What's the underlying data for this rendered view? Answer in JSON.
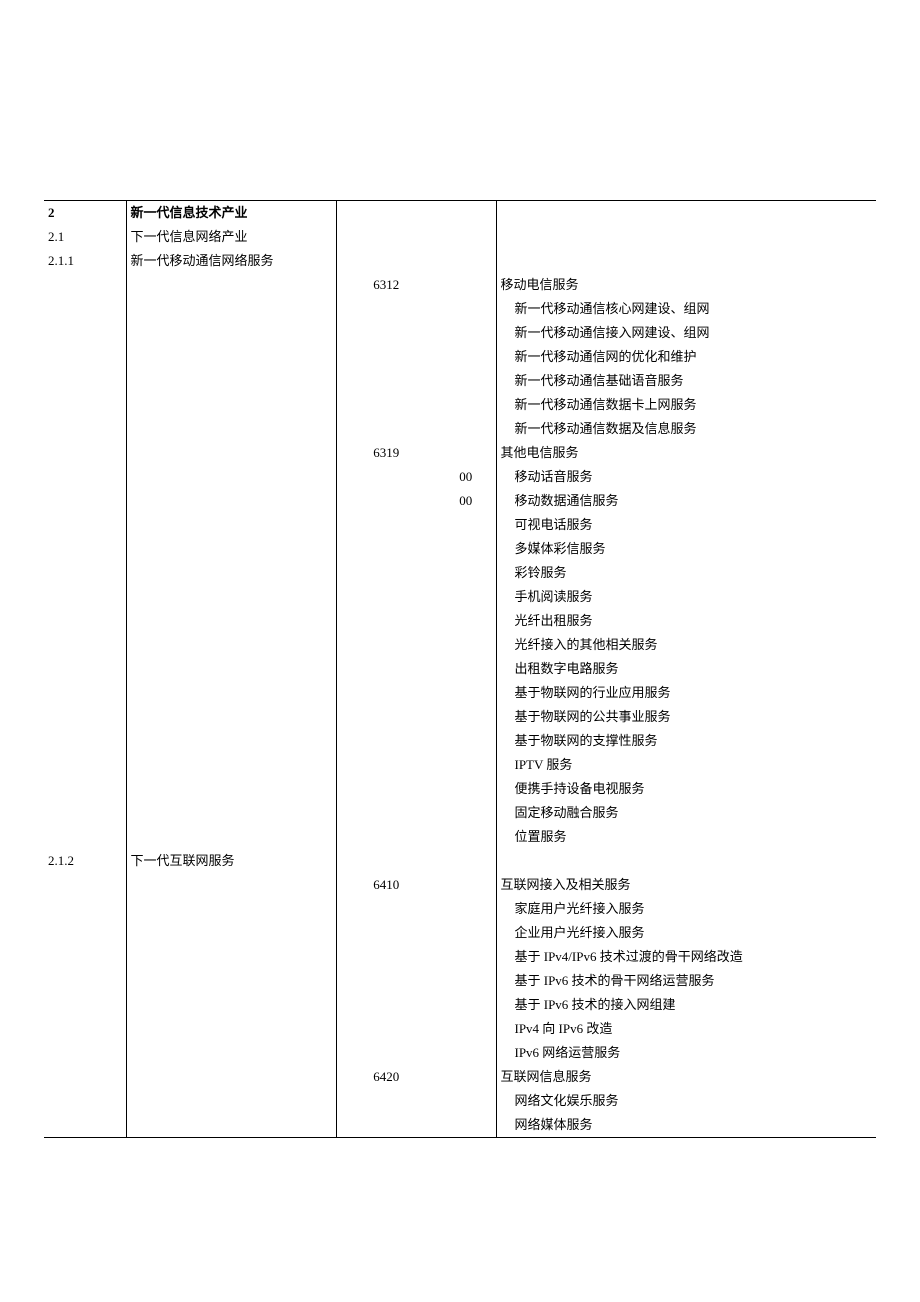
{
  "rows": [
    {
      "code": "2",
      "name": "新一代信息技术产业",
      "bold": true
    },
    {
      "code": "2.1",
      "name": "下一代信息网络产业"
    },
    {
      "code": "2.1.1",
      "name": "新一代移动通信网络服务"
    },
    {
      "num1": "6312",
      "desc": "移动电信服务"
    },
    {
      "desc": "新一代移动通信核心网建设、组网",
      "indent": 1
    },
    {
      "desc": "新一代移动通信接入网建设、组网",
      "indent": 1
    },
    {
      "desc": "新一代移动通信网的优化和维护",
      "indent": 1
    },
    {
      "desc": "新一代移动通信基础语音服务",
      "indent": 1
    },
    {
      "desc": "新一代移动通信数据卡上网服务",
      "indent": 1
    },
    {
      "desc": "新一代移动通信数据及信息服务",
      "indent": 1
    },
    {
      "num1": "6319",
      "desc": "其他电信服务"
    },
    {
      "num2": "00",
      "desc": "移动话音服务",
      "indent": 1
    },
    {
      "num2": "00",
      "desc": "移动数据通信服务",
      "indent": 1
    },
    {
      "desc": "可视电话服务",
      "indent": 1
    },
    {
      "desc": "多媒体彩信服务",
      "indent": 1
    },
    {
      "desc": "彩铃服务",
      "indent": 1
    },
    {
      "desc": "手机阅读服务",
      "indent": 1
    },
    {
      "desc": "光纤出租服务",
      "indent": 1
    },
    {
      "desc": "光纤接入的其他相关服务",
      "indent": 1
    },
    {
      "desc": "出租数字电路服务",
      "indent": 1
    },
    {
      "desc": "基于物联网的行业应用服务",
      "indent": 1
    },
    {
      "desc": "基于物联网的公共事业服务",
      "indent": 1
    },
    {
      "desc": "基于物联网的支撑性服务",
      "indent": 1
    },
    {
      "desc": "IPTV 服务",
      "indent": 1
    },
    {
      "desc": "便携手持设备电视服务",
      "indent": 1
    },
    {
      "desc": "固定移动融合服务",
      "indent": 1
    },
    {
      "desc": "位置服务",
      "indent": 1
    },
    {
      "code": "2.1.2",
      "name": "下一代互联网服务"
    },
    {
      "num1": "6410",
      "desc": "互联网接入及相关服务"
    },
    {
      "desc": "家庭用户光纤接入服务",
      "indent": 1
    },
    {
      "desc": "企业用户光纤接入服务",
      "indent": 1
    },
    {
      "desc": "基于 IPv4/IPv6 技术过渡的骨干网络改造",
      "indent": 1
    },
    {
      "desc": "基于 IPv6 技术的骨干网络运营服务",
      "indent": 1
    },
    {
      "desc": "基于 IPv6 技术的接入网组建",
      "indent": 1
    },
    {
      "desc": "IPv4 向 IPv6 改造",
      "indent": 1
    },
    {
      "desc": "IPv6 网络运营服务",
      "indent": 1
    },
    {
      "num1": "6420",
      "desc": "互联网信息服务"
    },
    {
      "desc": "网络文化娱乐服务",
      "indent": 1
    },
    {
      "desc": "网络媒体服务",
      "indent": 1
    }
  ]
}
